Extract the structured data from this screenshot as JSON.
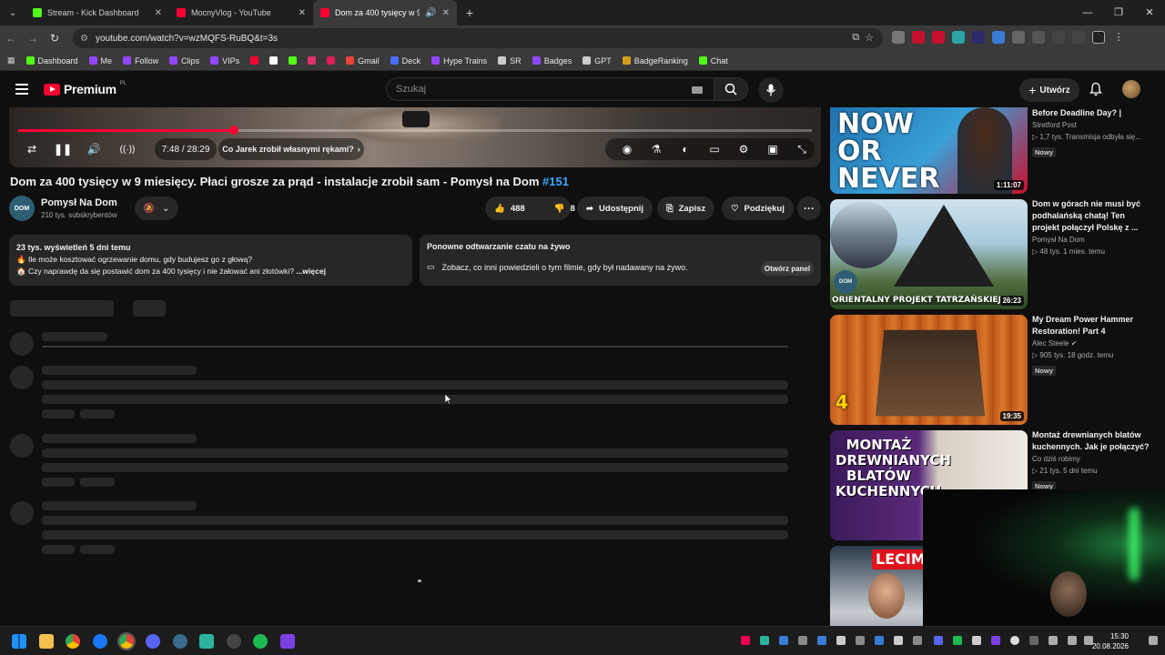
{
  "browser": {
    "tabs": [
      {
        "title": "Stream - Kick Dashboard",
        "color": "#53fc18"
      },
      {
        "title": "MocnyVlog - YouTube",
        "color": "#ff0033"
      },
      {
        "title": "Dom za 400 tysięcy w 9 mie",
        "color": "#ff0033"
      }
    ],
    "url": "youtube.com/watch?v=wzMQFS-RuBQ&t=3s",
    "bookmarks": [
      {
        "label": "Dashboard",
        "color": "#53fc18"
      },
      {
        "label": "Me",
        "color": "#9146ff"
      },
      {
        "label": "Follow",
        "color": "#9146ff"
      },
      {
        "label": "Clips",
        "color": "#9146ff"
      },
      {
        "label": "VIPs",
        "color": "#9146ff"
      },
      {
        "label": "",
        "color": "#ff0033"
      },
      {
        "label": "",
        "color": "#ffffff"
      },
      {
        "label": "",
        "color": "#53fc18"
      },
      {
        "label": "",
        "color": "#e1306c"
      },
      {
        "label": "",
        "color": "#e01e5a"
      },
      {
        "label": "Gmail",
        "color": "#ea4335"
      },
      {
        "label": "Deck",
        "color": "#4b6bfb"
      },
      {
        "label": "Hype Trains",
        "color": "#9146ff"
      },
      {
        "label": "SR",
        "color": "#cccccc"
      },
      {
        "label": "Badges",
        "color": "#9146ff"
      },
      {
        "label": "GPT",
        "color": "#cccccc"
      },
      {
        "label": "BadgeRanking",
        "color": "#d4a017"
      },
      {
        "label": "Chat",
        "color": "#53fc18"
      }
    ]
  },
  "youtube": {
    "logo_text": "Premium",
    "logo_region": "PL",
    "search_placeholder": "Szukaj",
    "create_label": "Utwórz"
  },
  "player": {
    "progress_fraction": 0.272,
    "time": "7:48 / 28:29",
    "chapter": "Co Jarek zrobił własnymi rękami?"
  },
  "video": {
    "title": "Dom za 400 tysięcy w 9 miesięcy. Płaci grosze za prąd - instalacje zrobił sam - Pomysł na Dom",
    "hashtag": "#151",
    "channel": "Pomysł Na Dom",
    "subscribers": "210 tys. subskrybentów",
    "likes": "488",
    "dislikes": "8",
    "share_label": "Udostępnij",
    "save_label": "Zapisz",
    "thanks_label": "Podziękuj",
    "more": "···"
  },
  "description": {
    "stats": "23 tys. wyświetleń  5 dni temu",
    "line1": "Ile może kosztować ogrzewanie domu, gdy budujesz go z głową?",
    "line2": "Czy naprawdę da się postawić dom za 400 tysięcy i nie żałować ani złotówki?",
    "more": "...więcej"
  },
  "chat_replay": {
    "title": "Ponowne odtwarzanie czatu na żywo",
    "text": "Zobacz, co inni powiedzieli o tym filmie, gdy był nadawany na żywo.",
    "button": "Otwórz panel"
  },
  "sidebar": [
    {
      "title": "Before Deadline Day? |",
      "channel": "Stretford Post",
      "meta": "1,7 tys.  Transmisja odbyła się...",
      "badge": "Nowy",
      "duration": "1:11:07",
      "thumb_text": "NOW OR NEVER"
    },
    {
      "title": "Dom w górach nie musi być podhalańską chatą! Ten projekt połączył Polskę z ...",
      "channel": "Pomysł Na Dom",
      "meta": "48 tys.  1 mies. temu",
      "badge": "",
      "duration": "26:23",
      "thumb_text": "ORIENTALNY PROJEKT TATRZAŃSKIEJ C"
    },
    {
      "title": "My Dream Power Hammer Restoration! Part 4",
      "channel": "Alec Steele",
      "meta": "905 tys.  18 godz. temu",
      "badge": "Nowy",
      "duration": "19:35",
      "thumb_text": "4"
    },
    {
      "title": "Montaż drewnianych blatów kuchennych. Jak je połączyć?",
      "channel": "Co dziś robimy",
      "meta": "21 tys.  5 dni temu",
      "badge": "Nowy",
      "duration": "",
      "thumb_text": "MONTAŻ DREWNIANYCH BLATÓW KUCHENNYCH"
    },
    {
      "title": "",
      "channel": "",
      "meta": "",
      "badge": "",
      "duration": "",
      "thumb_text": "LECIM"
    }
  ],
  "taskbar": {
    "time": "15:30",
    "date": "20.08.2026"
  }
}
